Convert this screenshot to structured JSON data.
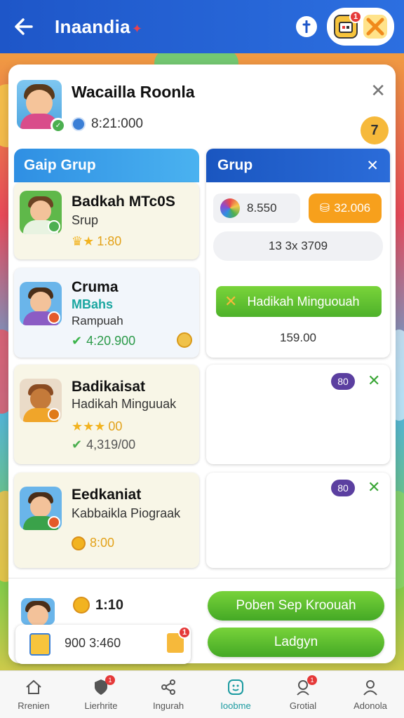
{
  "header": {
    "title": "Inaandia",
    "title_badge": "✦",
    "calendar_notif": "1"
  },
  "profile": {
    "name": "Wacailla Roonla",
    "coins": "8:21:000",
    "level": "7"
  },
  "left_panel": {
    "title": "Gaip Grup",
    "cards": [
      {
        "title": "Badkah MTc0S",
        "subtitle": "Srup",
        "stat": "1:80",
        "stat_icon": "crown-icon"
      },
      {
        "title": "Cruma",
        "subtitle": "MBahs",
        "line3": "Rampuah",
        "stat": "4:20.900"
      },
      {
        "title": "Badikaisat",
        "subtitle": "Hadikah Minguuak",
        "stat": "00",
        "stat2": "4,319/00"
      },
      {
        "title": "Eedkaniat",
        "subtitle": "Kabbaikla Piograak",
        "stat": "8:00"
      }
    ]
  },
  "right_panel": {
    "title": "Grup",
    "pill_grey_value": "8.550",
    "pill_orange_value": "32.006",
    "info_row": "13 3x 3709",
    "green_button": "Hadikah Minguouah",
    "amount": "159.00",
    "tag_1": "80",
    "tag_2": "80"
  },
  "bottom_area": {
    "reward_value": "1:10",
    "button_primary": "Poben Sep Kroouah",
    "button_secondary": "Ladgyn",
    "mini_card_value_a": "900",
    "mini_card_value_b": "3:460",
    "mini_notif": "1"
  },
  "nav": {
    "items": [
      {
        "label": "Rrenien",
        "icon": "home-icon"
      },
      {
        "label": "Lierhrite",
        "icon": "shield-icon",
        "badge": "1"
      },
      {
        "label": "Ingurah",
        "icon": "share-icon"
      },
      {
        "label": "Ioobme",
        "icon": "game-icon",
        "active": true
      },
      {
        "label": "Grotial",
        "icon": "user-icon",
        "badge": "1"
      },
      {
        "label": "Adonola",
        "icon": "profile-icon"
      }
    ]
  },
  "colors": {
    "header_blue": "#1e56c8",
    "accent_green": "#4eb12a",
    "accent_orange": "#f7a01c",
    "tag_purple": "#5b3fa0"
  }
}
